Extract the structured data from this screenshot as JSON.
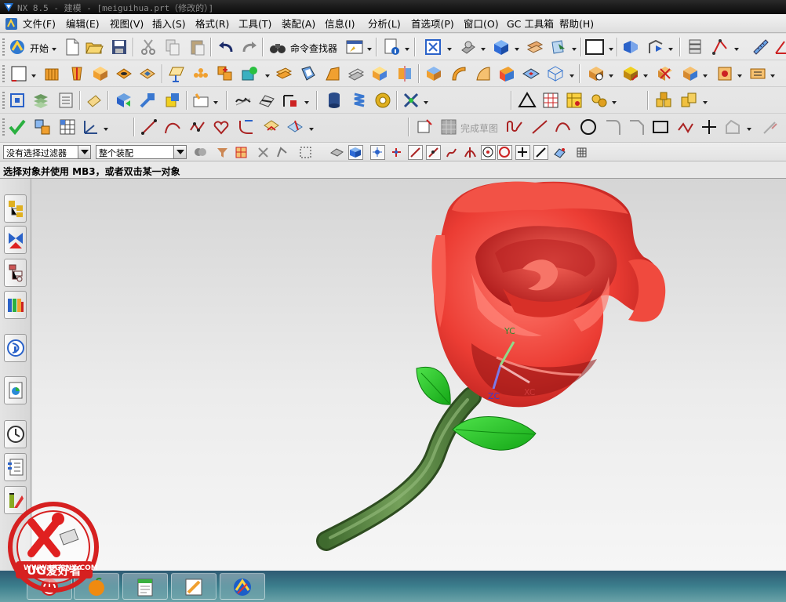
{
  "window": {
    "title": "NX 8.5 - 建模 - [meiguihua.prt（修改的）]"
  },
  "menu": {
    "items": [
      "文件(F)",
      "编辑(E)",
      "视图(V)",
      "插入(S)",
      "格式(R)",
      "工具(T)",
      "装配(A)",
      "信息(I)",
      "分析(L)",
      "首选项(P)",
      "窗口(O)",
      "GC 工具箱",
      "帮助(H)"
    ]
  },
  "toolbar": {
    "start_label": "开始",
    "command_finder_label": "命令查找器",
    "finish_sketch_label": "完成草图"
  },
  "selection_bar": {
    "type_filter": "没有选择过滤器",
    "scope": "整个装配"
  },
  "cue_line": {
    "text": "选择对象并使用 MB3，或者双击某一对象"
  },
  "viewport": {
    "axes": {
      "x": "XC",
      "y": "YC",
      "z": "ZC"
    },
    "model_colors": {
      "petal": "#e8382f",
      "leaf": "#22c020",
      "stem": "#4f7a3a",
      "background": "#e6e6e6"
    }
  },
  "resource_bar": {
    "tabs": [
      "assembly-navigator-icon",
      "constraint-navigator-icon",
      "part-navigator-icon",
      "reuse-library-icon",
      "roles-icon",
      "web-browser-icon",
      "history-icon",
      "system-materials-icon",
      "palette-icon"
    ]
  },
  "taskbar": {
    "buttons": [
      "shutdown-app-icon",
      "orange-app-icon",
      "notepad-app-icon",
      "pencil-app-icon",
      "nx-app-icon"
    ]
  },
  "watermark": {
    "brand": "UG爱好者",
    "url": "WWW.UGSNX.COM"
  }
}
